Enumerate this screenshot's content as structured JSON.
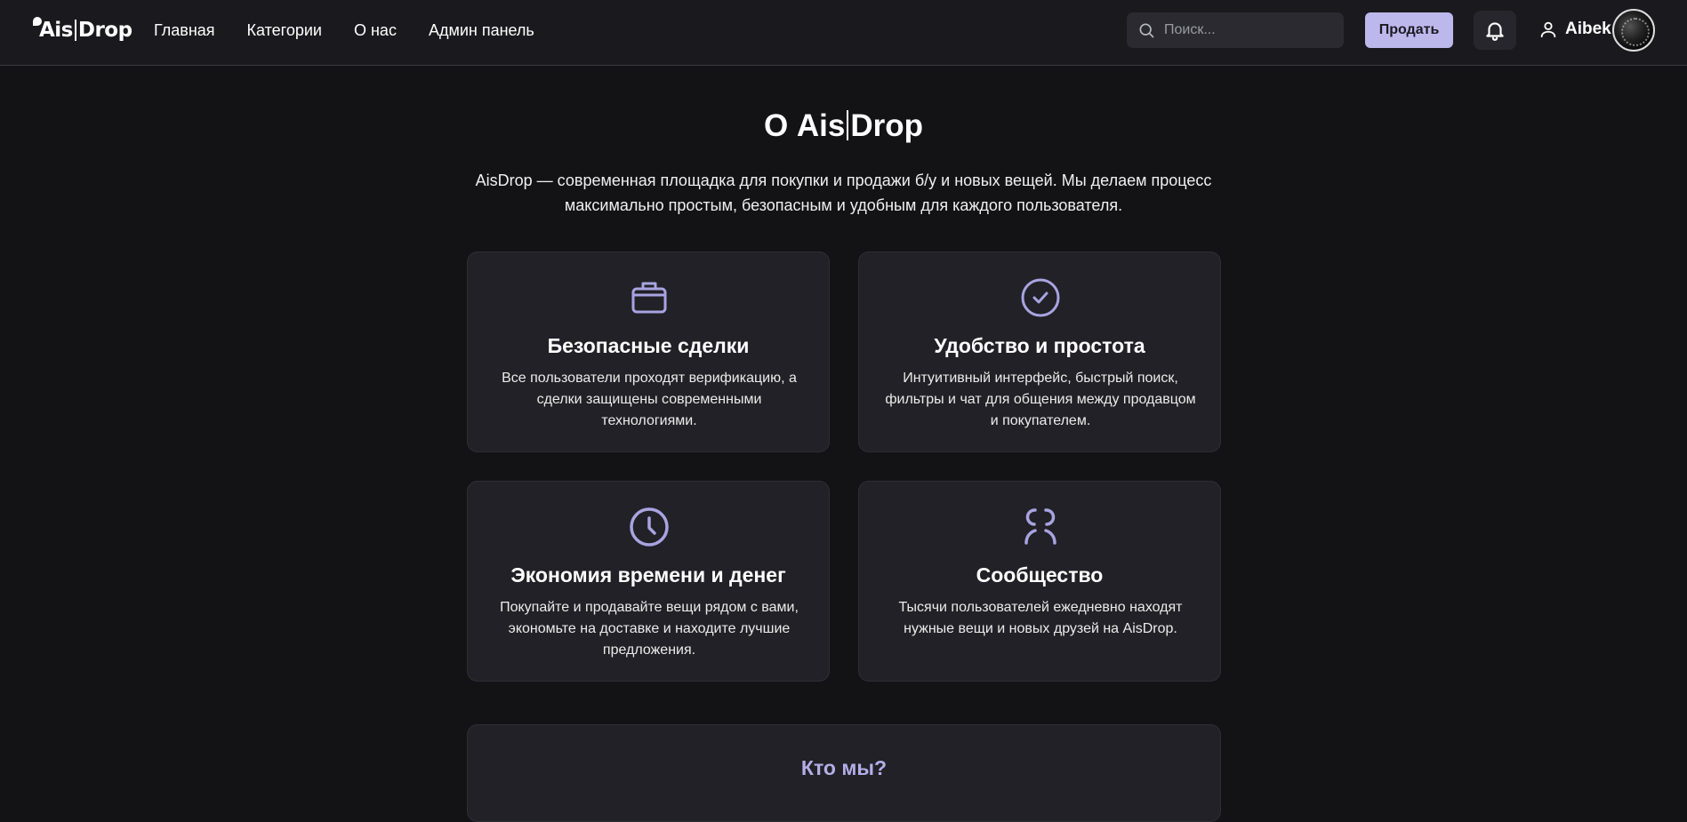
{
  "header": {
    "logo": {
      "left": "Ais",
      "right": "Drop"
    },
    "nav": [
      "Главная",
      "Категории",
      "О нас",
      "Админ панель"
    ],
    "search_placeholder": "Поиск...",
    "sell_label": "Продать",
    "username": "Aibek"
  },
  "main": {
    "title_prefix": "О ",
    "title_left": "Ais",
    "title_right": "Drop",
    "intro": "AisDrop — современная площадка для покупки и продажи б/у и новых вещей. Мы делаем процесс максимально простым, безопасным и удобным для каждого пользователя.",
    "features": [
      {
        "icon": "briefcase-icon",
        "title": "Безопасные сделки",
        "text": "Все пользователи проходят верификацию, а сделки защищены современными технологиями."
      },
      {
        "icon": "check-circle-icon",
        "title": "Удобство и простота",
        "text": "Интуитивный интерфейс, быстрый поиск, фильтры и чат для общения между продавцом и покупателем."
      },
      {
        "icon": "clock-icon",
        "title": "Экономия времени и денег",
        "text": "Покупайте и продавайте вещи рядом с вами, экономьте на доставке и находите лучшие предложения."
      },
      {
        "icon": "community-icon",
        "title": "Сообщество",
        "text": "Тысячи пользователей ежедневно находят нужные вещи и новых друзей на AisDrop."
      }
    ],
    "who_title": "Кто мы?"
  },
  "colors": {
    "accent": "#bdb8ec",
    "icon": "#a9a3e0",
    "background": "#131316",
    "card": "#212127"
  }
}
